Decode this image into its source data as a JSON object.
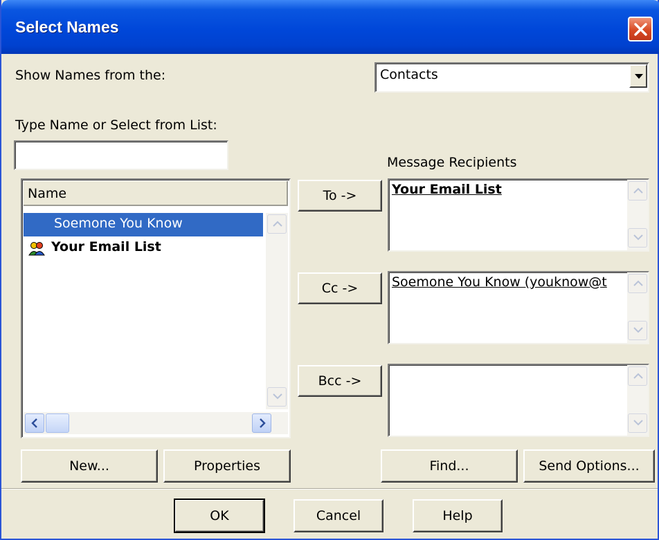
{
  "window": {
    "title": "Select Names"
  },
  "show_names": {
    "label": "Show Names from the:",
    "selected": "Contacts"
  },
  "type_name": {
    "label": "Type Name or Select from List:",
    "value": ""
  },
  "list": {
    "header": "Name",
    "items": [
      {
        "label": "Soemone You Know",
        "selected": true,
        "bold": false
      },
      {
        "label": "Your Email List",
        "selected": false,
        "bold": true,
        "icon": "distribution-list-icon"
      }
    ]
  },
  "recipients": {
    "label": "Message Recipients",
    "to": {
      "button": "To ->",
      "value": "Your Email List"
    },
    "cc": {
      "button": "Cc ->",
      "value": "Soemone You Know (youknow@t"
    },
    "bcc": {
      "button": "Bcc ->",
      "value": ""
    }
  },
  "buttons": {
    "new": "New...",
    "properties": "Properties",
    "find": "Find...",
    "send_options": "Send Options...",
    "ok": "OK",
    "cancel": "Cancel",
    "help": "Help"
  },
  "colors": {
    "titlebar": "#0047d9",
    "dialog_bg": "#ece9d8",
    "selection": "#316ac5",
    "close_button": "#d84a24"
  }
}
